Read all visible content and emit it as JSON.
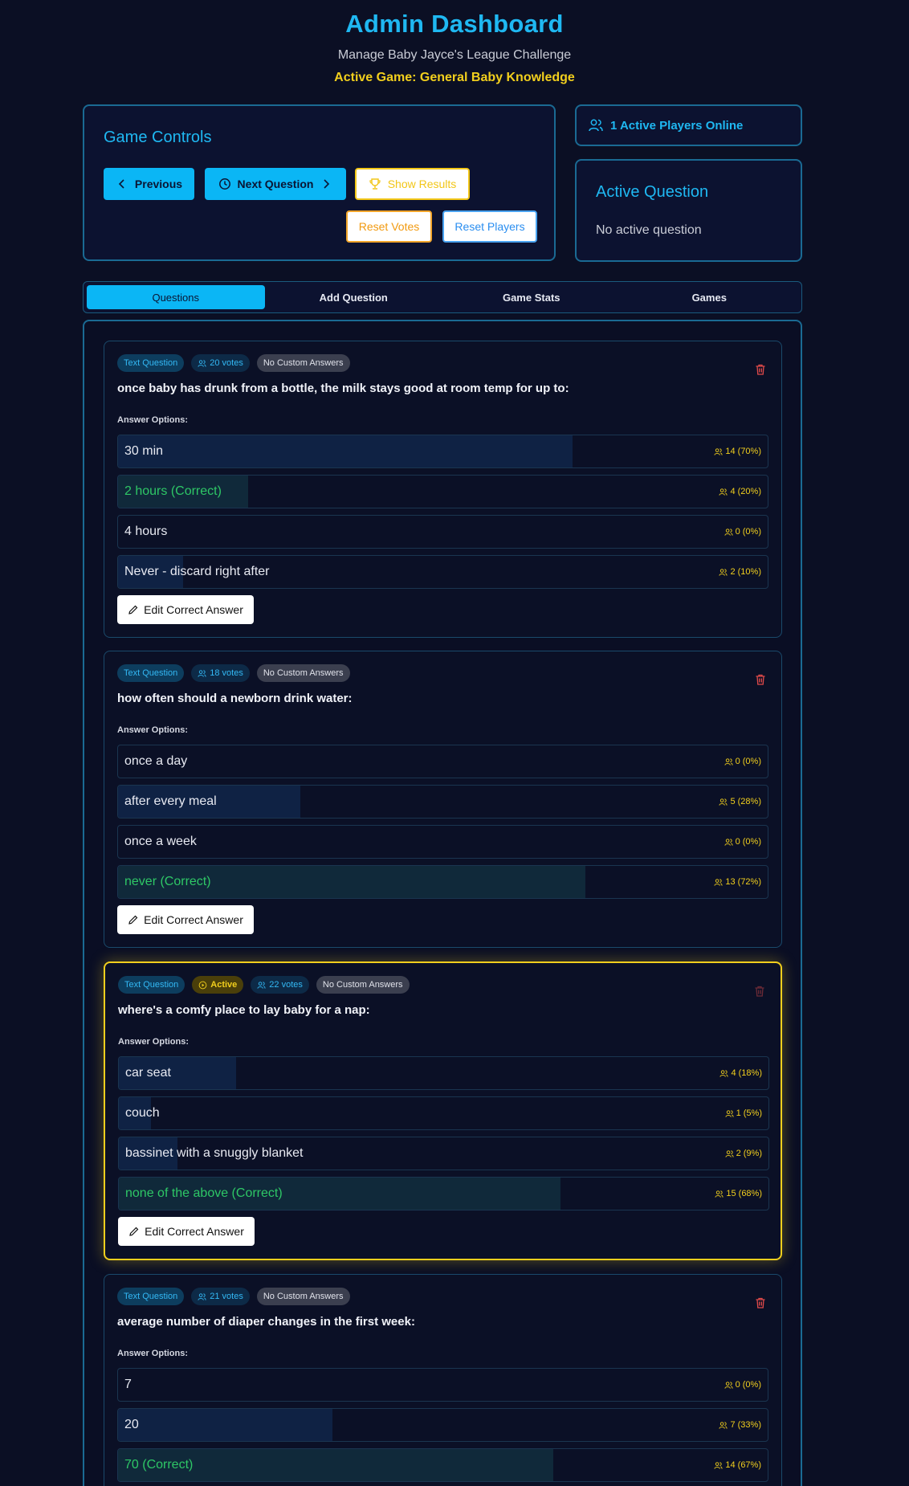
{
  "header": {
    "title": "Admin Dashboard",
    "subtitle": "Manage Baby Jayce's League Challenge",
    "active_game": "Active Game: General Baby Knowledge"
  },
  "controls": {
    "title": "Game Controls",
    "previous": "Previous",
    "next": "Next Question",
    "show_results": "Show Results",
    "reset_votes": "Reset Votes",
    "reset_players": "Reset Players"
  },
  "players": {
    "label": "1 Active Players Online"
  },
  "active_question": {
    "title": "Active Question",
    "text": "No active question"
  },
  "tabs": [
    {
      "label": "Questions",
      "active": true
    },
    {
      "label": "Add Question",
      "active": false
    },
    {
      "label": "Game Stats",
      "active": false
    },
    {
      "label": "Games",
      "active": false
    }
  ],
  "questions": [
    {
      "type": "Text Question",
      "votes": "20 votes",
      "custom": "No Custom Answers",
      "text": "once baby has drunk from a bottle, the milk stays good at room temp for up to:",
      "options_label": "Answer Options:",
      "edit_label": "Edit Correct Answer",
      "options": [
        {
          "label": "30 min",
          "count": "14 (70%)",
          "fraction": 0.7,
          "correct": false
        },
        {
          "label": "2 hours (Correct)",
          "count": "4 (20%)",
          "fraction": 0.2,
          "correct": true
        },
        {
          "label": "4 hours",
          "count": "0 (0%)",
          "fraction": 0.0,
          "correct": false
        },
        {
          "label": "Never - discard right after",
          "count": "2 (10%)",
          "fraction": 0.1,
          "correct": false
        }
      ]
    },
    {
      "type": "Text Question",
      "votes": "18 votes",
      "custom": "No Custom Answers",
      "text": "how often should a newborn drink water:",
      "options_label": "Answer Options:",
      "edit_label": "Edit Correct Answer",
      "options": [
        {
          "label": "once a day",
          "count": "0 (0%)",
          "fraction": 0.0,
          "correct": false
        },
        {
          "label": "after every meal",
          "count": "5 (28%)",
          "fraction": 0.28,
          "correct": false
        },
        {
          "label": "once a week",
          "count": "0 (0%)",
          "fraction": 0.0,
          "correct": false
        },
        {
          "label": "never (Correct)",
          "count": "13 (72%)",
          "fraction": 0.72,
          "correct": true
        }
      ]
    },
    {
      "type": "Text Question",
      "active_label": "Active",
      "votes": "22 votes",
      "custom": "No Custom Answers",
      "text": "where's a comfy place to lay baby for a nap:",
      "options_label": "Answer Options:",
      "edit_label": "Edit Correct Answer",
      "options": [
        {
          "label": "car seat",
          "count": "4 (18%)",
          "fraction": 0.18,
          "correct": false
        },
        {
          "label": "couch",
          "count": "1 (5%)",
          "fraction": 0.05,
          "correct": false
        },
        {
          "label": "bassinet with a snuggly blanket",
          "count": "2 (9%)",
          "fraction": 0.09,
          "correct": false
        },
        {
          "label": "none of the above (Correct)",
          "count": "15 (68%)",
          "fraction": 0.68,
          "correct": true
        }
      ]
    },
    {
      "type": "Text Question",
      "votes": "21 votes",
      "custom": "No Custom Answers",
      "text": "average number of diaper changes in the first week:",
      "options_label": "Answer Options:",
      "options": [
        {
          "label": "7",
          "count": "0 (0%)",
          "fraction": 0.0,
          "correct": false
        },
        {
          "label": "20",
          "count": "7 (33%)",
          "fraction": 0.33,
          "correct": false
        },
        {
          "label": "70 (Correct)",
          "count": "14 (67%)",
          "fraction": 0.67,
          "correct": true
        }
      ]
    }
  ],
  "colors": {
    "accent": "#0bb6f5",
    "gold": "#f2cf1d",
    "correct": "#2ec766",
    "background": "#0b0f24"
  },
  "icons": {
    "users": "users-icon",
    "trash": "trash-icon",
    "pencil": "pencil-icon",
    "clock": "clock-icon",
    "trophy": "trophy-icon",
    "play": "play-circle-icon"
  }
}
